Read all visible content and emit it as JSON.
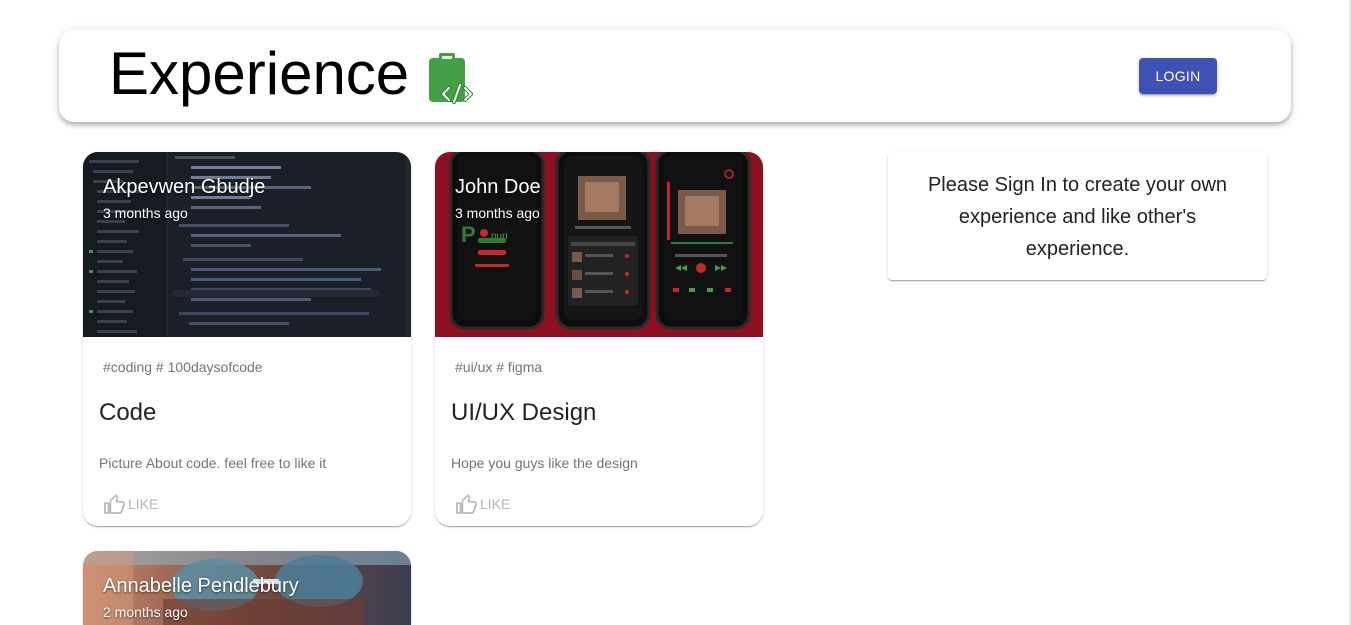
{
  "header": {
    "title": "Experience",
    "brand_icon": "clipboard-code-icon",
    "login_label": "LOGIN",
    "accent_color": "#3f51b5"
  },
  "posts": [
    {
      "author": "Akpevwen Gbudje",
      "time": "3 months ago",
      "tags": "#coding # 100daysofcode",
      "title": "Code",
      "description": "Picture About code. feel free to like it",
      "like_label": "LIKE",
      "image": "code-editor-screenshot"
    },
    {
      "author": "John Doe",
      "time": "3 months ago",
      "tags": "#ui/ux # figma",
      "title": "UI/UX Design",
      "description": "Hope you guys like the design",
      "like_label": "LIKE",
      "image": "music-app-mockups"
    },
    {
      "author": "Annabelle Pendlebury",
      "time": "2 months ago",
      "image": "portrait-with-sunglasses"
    }
  ],
  "signin_prompt": "Please Sign In to create your own experience and like other's experience."
}
